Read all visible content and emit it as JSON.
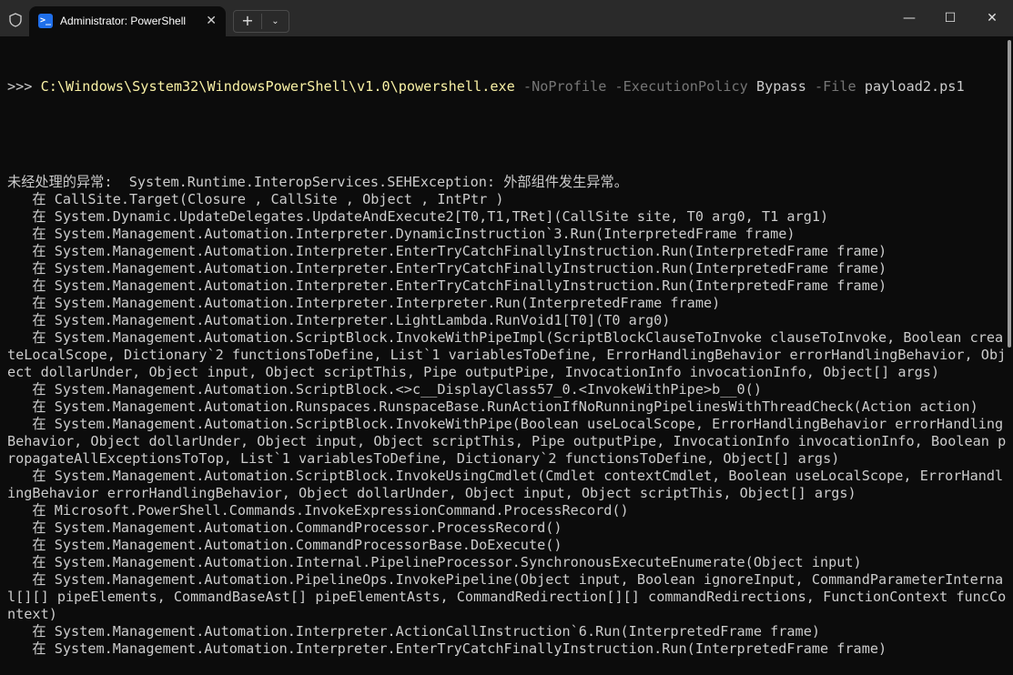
{
  "window": {
    "tab_title": "Administrator: PowerShell",
    "tab_icon": "powershell-icon",
    "new_tab": "+",
    "dropdown": "⌄",
    "minimize": "—",
    "maximize": "☐",
    "close": "✕",
    "tab_close": "✕"
  },
  "command": {
    "prompt": ">>> ",
    "exe": "C:\\Windows\\System32\\WindowsPowerShell\\v1.0\\powershell.exe",
    "p1": " -NoProfile",
    "p2": " -ExecutionPolicy",
    "a2": " Bypass",
    "p3": " -File",
    "a3": " payload2.ps1"
  },
  "output": [
    "未经处理的异常:  System.Runtime.InteropServices.SEHException: 外部组件发生异常。",
    "   在 CallSite.Target(Closure , CallSite , Object , IntPtr )",
    "   在 System.Dynamic.UpdateDelegates.UpdateAndExecute2[T0,T1,TRet](CallSite site, T0 arg0, T1 arg1)",
    "   在 System.Management.Automation.Interpreter.DynamicInstruction`3.Run(InterpretedFrame frame)",
    "   在 System.Management.Automation.Interpreter.EnterTryCatchFinallyInstruction.Run(InterpretedFrame frame)",
    "   在 System.Management.Automation.Interpreter.EnterTryCatchFinallyInstruction.Run(InterpretedFrame frame)",
    "   在 System.Management.Automation.Interpreter.EnterTryCatchFinallyInstruction.Run(InterpretedFrame frame)",
    "   在 System.Management.Automation.Interpreter.Interpreter.Run(InterpretedFrame frame)",
    "   在 System.Management.Automation.Interpreter.LightLambda.RunVoid1[T0](T0 arg0)",
    "   在 System.Management.Automation.ScriptBlock.InvokeWithPipeImpl(ScriptBlockClauseToInvoke clauseToInvoke, Boolean crea",
    "teLocalScope, Dictionary`2 functionsToDefine, List`1 variablesToDefine, ErrorHandlingBehavior errorHandlingBehavior, Obj",
    "ect dollarUnder, Object input, Object scriptThis, Pipe outputPipe, InvocationInfo invocationInfo, Object[] args)",
    "   在 System.Management.Automation.ScriptBlock.<>c__DisplayClass57_0.<InvokeWithPipe>b__0()",
    "   在 System.Management.Automation.Runspaces.RunspaceBase.RunActionIfNoRunningPipelinesWithThreadCheck(Action action)",
    "   在 System.Management.Automation.ScriptBlock.InvokeWithPipe(Boolean useLocalScope, ErrorHandlingBehavior errorHandling",
    "Behavior, Object dollarUnder, Object input, Object scriptThis, Pipe outputPipe, InvocationInfo invocationInfo, Boolean p",
    "ropagateAllExceptionsToTop, List`1 variablesToDefine, Dictionary`2 functionsToDefine, Object[] args)",
    "   在 System.Management.Automation.ScriptBlock.InvokeUsingCmdlet(Cmdlet contextCmdlet, Boolean useLocalScope, ErrorHandl",
    "ingBehavior errorHandlingBehavior, Object dollarUnder, Object input, Object scriptThis, Object[] args)",
    "   在 Microsoft.PowerShell.Commands.InvokeExpressionCommand.ProcessRecord()",
    "   在 System.Management.Automation.CommandProcessor.ProcessRecord()",
    "   在 System.Management.Automation.CommandProcessorBase.DoExecute()",
    "   在 System.Management.Automation.Internal.PipelineProcessor.SynchronousExecuteEnumerate(Object input)",
    "   在 System.Management.Automation.PipelineOps.InvokePipeline(Object input, Boolean ignoreInput, CommandParameterInterna",
    "l[][] pipeElements, CommandBaseAst[] pipeElementAsts, CommandRedirection[][] commandRedirections, FunctionContext funcCo",
    "ntext)",
    "   在 System.Management.Automation.Interpreter.ActionCallInstruction`6.Run(InterpretedFrame frame)",
    "   在 System.Management.Automation.Interpreter.EnterTryCatchFinallyInstruction.Run(InterpretedFrame frame)"
  ],
  "colors": {
    "background": "#0c0c0c",
    "titlebar": "#2a2a2a",
    "text": "#cccccc",
    "command": "#f9f1a5",
    "parameter": "#767676"
  }
}
